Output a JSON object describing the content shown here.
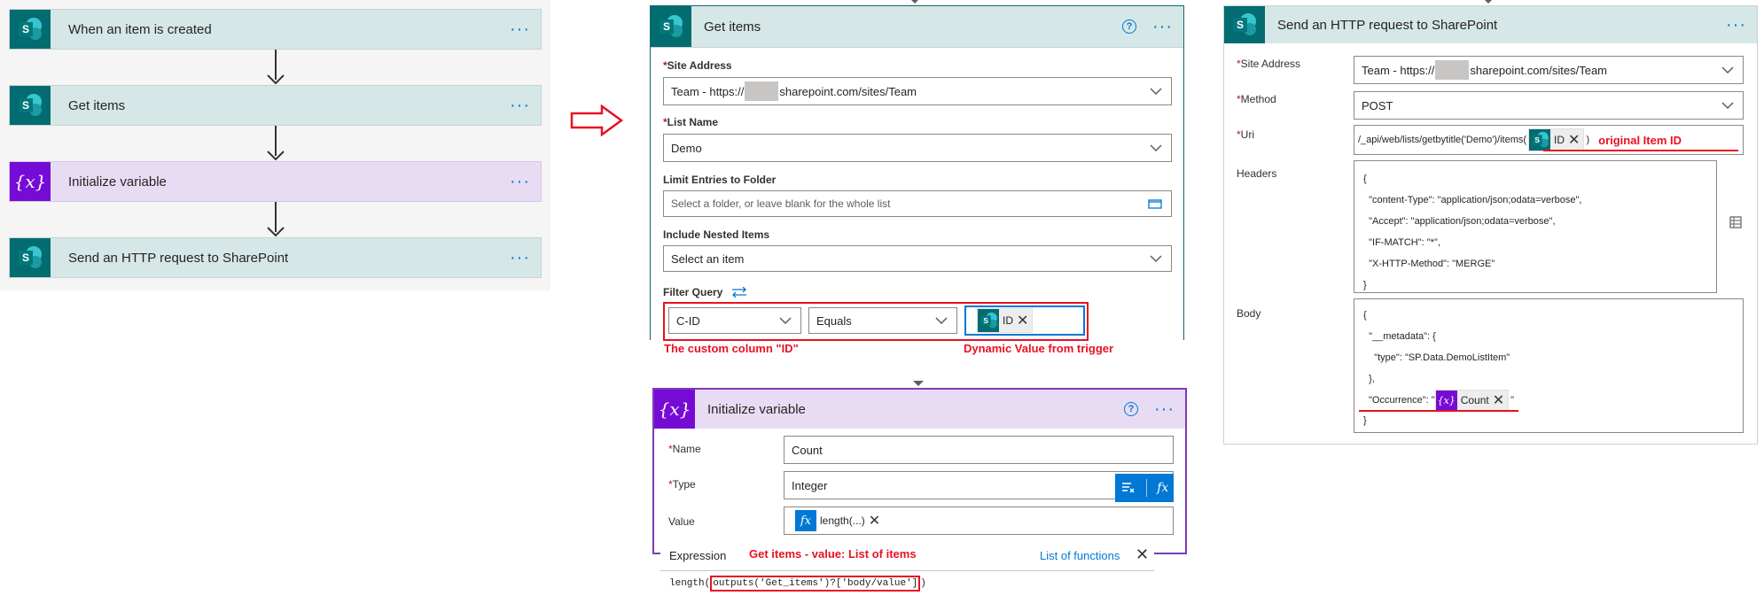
{
  "overview": {
    "steps": [
      {
        "title": "When an item is created",
        "kind": "sharepoint"
      },
      {
        "title": "Get items",
        "kind": "sharepoint"
      },
      {
        "title": "Initialize variable",
        "kind": "variable"
      },
      {
        "title": "Send an HTTP request to SharePoint",
        "kind": "sharepoint"
      }
    ],
    "menu_glyph": "···"
  },
  "get_items": {
    "title": "Get items",
    "help": "?",
    "menu_glyph": "···",
    "site_address": {
      "label": "Site Address",
      "required": "*",
      "value_prefix": "Team - https://",
      "value_suffix": "sharepoint.com/sites/Team"
    },
    "list_name": {
      "label": "List Name",
      "required": "*",
      "value": "Demo"
    },
    "limit_folder": {
      "label": "Limit Entries to Folder",
      "placeholder": "Select a folder, or leave blank for the whole list"
    },
    "nested": {
      "label": "Include Nested Items",
      "placeholder": "Select an item"
    },
    "filter": {
      "label": "Filter Query",
      "column": "C-ID",
      "operator": "Equals",
      "token": "ID"
    },
    "annotations": {
      "custom_column": "The custom column \"ID\"",
      "dynamic": "Dynamic Value from trigger"
    }
  },
  "init_var": {
    "title": "Initialize variable",
    "help": "?",
    "menu_glyph": "···",
    "name": {
      "label": "Name",
      "required": "*",
      "value": "Count"
    },
    "type": {
      "label": "Type",
      "required": "*",
      "value": "Integer"
    },
    "value": {
      "label": "Value",
      "token": "length(...)"
    },
    "fx_label": "fx",
    "expression": {
      "tab": "Expression",
      "annotation": "Get items - value: List of items",
      "list_link": "List of functions",
      "code_prefix": "length(",
      "code_inner": "outputs('Get_items')?['body/value']",
      "code_suffix": ")"
    }
  },
  "http": {
    "title": "Send an HTTP request to SharePoint",
    "menu_glyph": "···",
    "site_address": {
      "label": "Site Address",
      "required": "*",
      "value_prefix": "Team - https://",
      "value_suffix": "sharepoint.com/sites/Team"
    },
    "method": {
      "label": "Method",
      "required": "*",
      "value": "POST"
    },
    "uri": {
      "label": "Uri",
      "required": "*",
      "prefix": "/_api/web/lists/getbytitle('Demo')/items(",
      "token": "ID",
      "suffix": ")",
      "annotation": "original Item ID"
    },
    "headers": {
      "label": "Headers",
      "lines": [
        "{",
        "  \"content-Type\": \"application/json;odata=verbose\",",
        "  \"Accept\": \"application/json;odata=verbose\",",
        "  \"IF-MATCH\": \"*\",",
        "  \"X-HTTP-Method\": \"MERGE\"",
        "}"
      ]
    },
    "body": {
      "label": "Body",
      "lines": [
        "{",
        "  \"__metadata\": {",
        "    \"type\": \"SP.Data.DemoListItem\"",
        "  },"
      ],
      "occ_prefix": "\"Occurrence\": \"",
      "occ_token": "Count",
      "occ_suffix": "\"",
      "close": "}"
    }
  }
}
